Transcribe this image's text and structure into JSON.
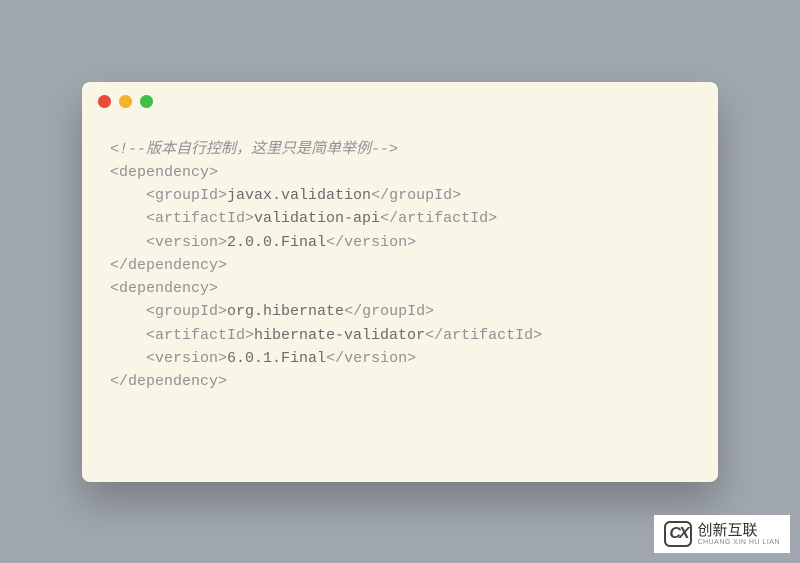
{
  "code": {
    "comment": "<!--版本自行控制，这里只是简单举例-->",
    "dep1": {
      "open": "<dependency>",
      "groupId_open": "    <groupId>",
      "groupId_val": "javax.validation",
      "groupId_close": "</groupId>",
      "artifactId_open": "    <artifactId>",
      "artifactId_val": "validation-api",
      "artifactId_close": "</artifactId>",
      "version_open": "    <version>",
      "version_val": "2.0.0.Final",
      "version_close": "</version>",
      "close": "</dependency>"
    },
    "dep2": {
      "open": "<dependency>",
      "groupId_open": "    <groupId>",
      "groupId_val": "org.hibernate",
      "groupId_close": "</groupId>",
      "artifactId_open": "    <artifactId>",
      "artifactId_val": "hibernate-validator",
      "artifactId_close": "</artifactId>",
      "version_open": "    <version>",
      "version_val": "6.0.1.Final",
      "version_close": "</version>",
      "close": "</dependency>"
    }
  },
  "logo": {
    "icon_text": "CX",
    "main": "创新互联",
    "sub": "CHUANG XIN HU LIAN"
  }
}
